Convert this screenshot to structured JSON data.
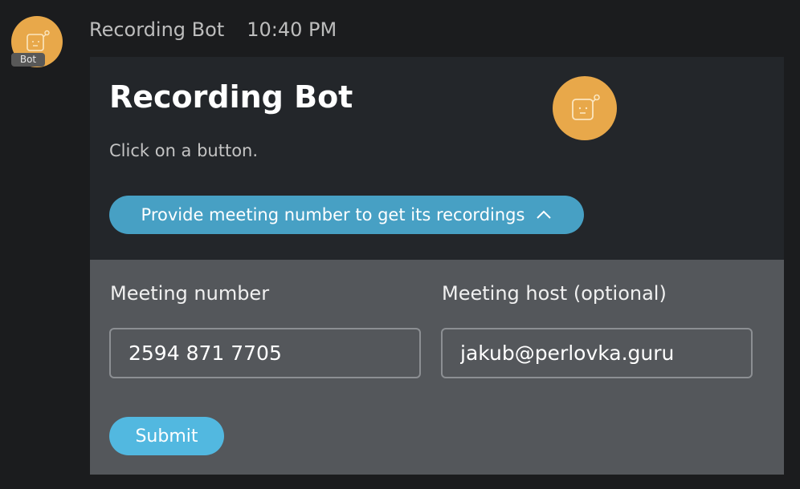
{
  "message": {
    "sender": "Recording Bot",
    "time": "10:40 PM",
    "avatar_badge": "Bot",
    "avatar_icon": "bot-face-icon"
  },
  "card": {
    "title": "Recording Bot",
    "subtitle": "Click on a button.",
    "image_icon": "bot-face-icon",
    "toggle_button_label": "Provide meeting number to get its recordings",
    "toggle_icon": "chevron-up-icon",
    "form": {
      "meeting_number_label": "Meeting number",
      "meeting_number_value": "2594 871 7705",
      "meeting_host_label": "Meeting host (optional)",
      "meeting_host_value": "jakub@perlovka.guru",
      "submit_label": "Submit"
    }
  },
  "colors": {
    "background": "#1b1c1e",
    "card": "#23262a",
    "form_panel": "#54575b",
    "avatar": "#e8a84a",
    "toggle_button": "#47a0c4",
    "submit_button": "#52b8e0"
  }
}
